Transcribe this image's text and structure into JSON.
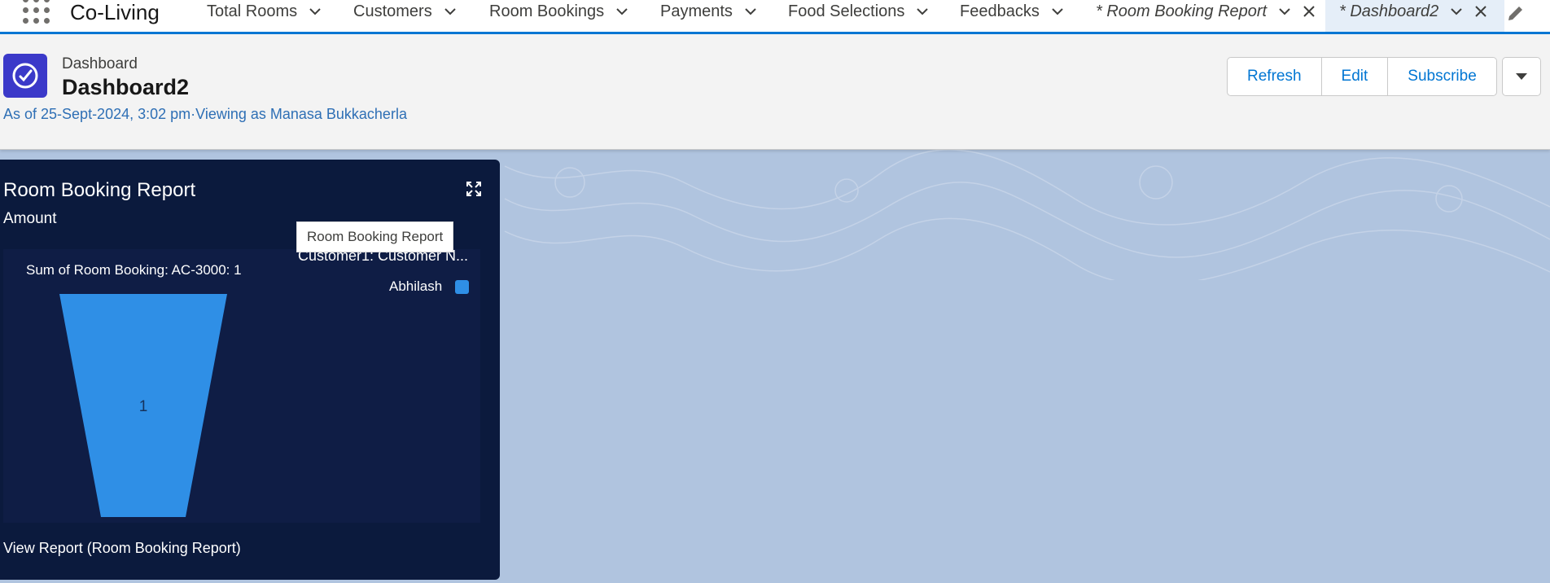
{
  "app": {
    "name": "Co-Living"
  },
  "nav": {
    "items": [
      {
        "label": "Total Rooms"
      },
      {
        "label": "Customers"
      },
      {
        "label": "Room Bookings"
      },
      {
        "label": "Payments"
      },
      {
        "label": "Food Selections"
      },
      {
        "label": "Feedbacks"
      }
    ],
    "tabs": [
      {
        "label": "* Room Booking Report"
      },
      {
        "label": "* Dashboard2"
      }
    ]
  },
  "header": {
    "breadcrumb": "Dashboard",
    "title": "Dashboard2",
    "meta": "As of 25-Sept-2024, 3:02 pm·Viewing as Manasa Bukkacherla",
    "buttons": {
      "refresh": "Refresh",
      "edit": "Edit",
      "subscribe": "Subscribe"
    }
  },
  "widget": {
    "title": "Room Booking Report",
    "subtitle": "Amount",
    "tooltip": "Room Booking Report",
    "view_report": "View Report (Room Booking Report)"
  },
  "chart_data": {
    "type": "funnel",
    "title": "Sum of Room Booking: AC-3000: 1",
    "legend_title": "Customer1: Customer  N...",
    "legend_position": "top-right",
    "series": [
      {
        "name": "Abhilash",
        "value": 1,
        "color": "#2f8fe6"
      }
    ]
  },
  "colors": {
    "accent": "#0176d3",
    "card_bg": "#0b1a3d",
    "page_bg": "#b0c4df"
  }
}
